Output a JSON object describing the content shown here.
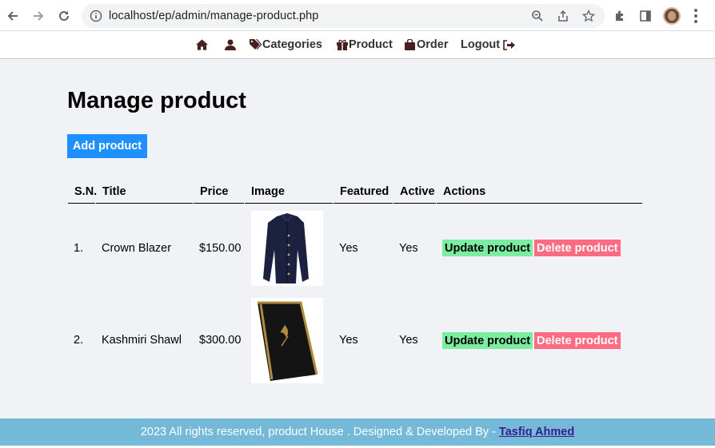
{
  "browser": {
    "url": "localhost/ep/admin/manage-product.php"
  },
  "nav": {
    "categories": "Categories",
    "product": "Product",
    "order": "Order",
    "logout": "Logout"
  },
  "page": {
    "title": "Manage product",
    "add_button": "Add product"
  },
  "table": {
    "headers": [
      "S.N.",
      "Title",
      "Price",
      "Image",
      "Featured",
      "Active",
      "Actions"
    ],
    "rows": [
      {
        "sn": "1.",
        "title": "Crown Blazer",
        "price": "$150.00",
        "image": "blazer",
        "featured": "Yes",
        "active": "Yes",
        "update": "Update product",
        "delete": "Delete product"
      },
      {
        "sn": "2.",
        "title": "Kashmiri Shawl",
        "price": "$300.00",
        "image": "shawl",
        "featured": "Yes",
        "active": "Yes",
        "update": "Update product",
        "delete": "Delete product"
      }
    ]
  },
  "footer": {
    "text": "2023 All rights reserved, product House . Designed & Developed By -",
    "author": "Tasfiq Ahmed"
  },
  "colors": {
    "add_button": "#1e90ff",
    "update_button": "#7bed9f",
    "delete_button": "#ff6b81",
    "footer": "#74b9d8",
    "main_bg": "#f1f2f6"
  }
}
